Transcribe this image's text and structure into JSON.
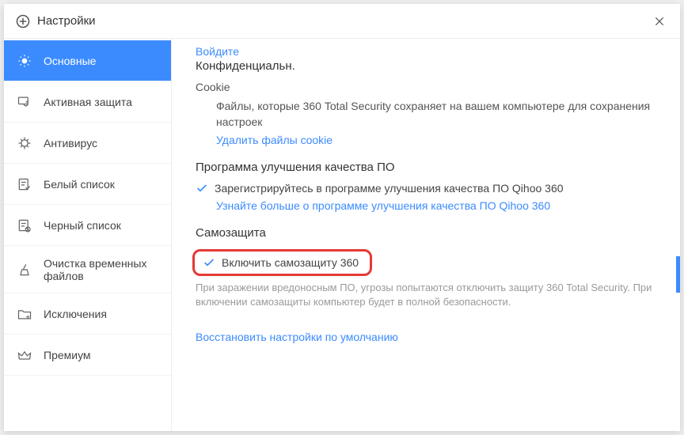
{
  "window": {
    "title": "Настройки"
  },
  "sidebar": {
    "items": [
      {
        "label": "Основные"
      },
      {
        "label": "Активная защита"
      },
      {
        "label": "Антивирус"
      },
      {
        "label": "Белый список"
      },
      {
        "label": "Черный список"
      },
      {
        "label": "Очистка временных файлов"
      },
      {
        "label": "Исключения"
      },
      {
        "label": "Премиум"
      }
    ]
  },
  "content": {
    "login_link": "Войдите",
    "privacy_title": "Конфиденциальн.",
    "cookie_title": "Cookie",
    "cookie_desc": "Файлы, которые 360 Total Security сохраняет на вашем компьютере для сохранения настроек",
    "cookie_link": "Удалить файлы cookie",
    "improve_title": "Программа улучшения качества ПО",
    "improve_check": "Зарегистрируйтесь в программе улучшения качества ПО Qihoo 360",
    "improve_link": "Узнайте больше о программе улучшения качества ПО Qihoo 360",
    "selfprotect_title": "Самозащита",
    "selfprotect_check": "Включить самозащиту 360",
    "selfprotect_desc": "При заражении вредоносным ПО, угрозы попытаются отключить защиту 360 Total Security. При включении самозащиты компьютер будет в полной безопасности.",
    "restore_link": "Восстановить настройки по умолчанию"
  }
}
